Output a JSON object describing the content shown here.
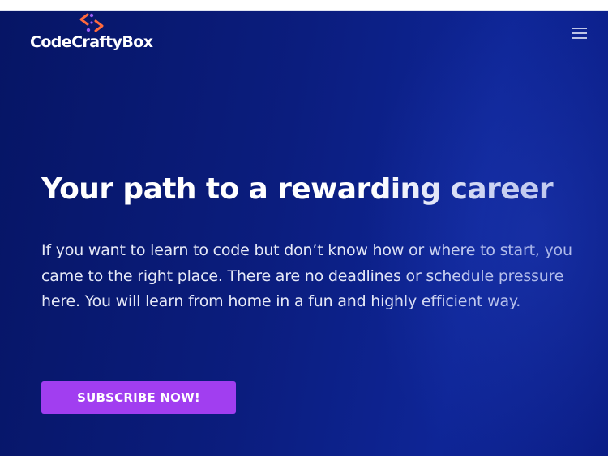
{
  "header": {
    "logo_text": "CodeCraftyBox",
    "logo_icon": "code-brackets-icon",
    "menu_icon": "hamburger-menu-icon"
  },
  "hero": {
    "headline": "Your path to a rewarding career",
    "intro": "If you want to learn to code but don’t know how or where to start, you came to the right place. There are no deadlines or schedule pressure here. You will learn from home in a fun and highly efficient way.",
    "cta_label": "SUBSCRIBE NOW!"
  },
  "colors": {
    "hero_background": "#0b1d7e",
    "cta_background": "#a13ef0",
    "logo_accent_orange": "#ff6a3d",
    "logo_accent_purple": "#9b5cf6",
    "text": "#ffffff"
  }
}
